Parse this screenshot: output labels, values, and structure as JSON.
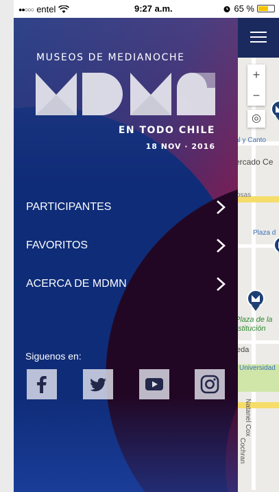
{
  "status_bar": {
    "carrier": "entel",
    "signal_dots": "●●○○○",
    "time": "9:27 a.m.",
    "battery_percent": "65 %",
    "battery_level": 0.65
  },
  "map": {
    "zoom_in": "+",
    "zoom_out": "−",
    "labels": [
      "al y Canto",
      "ercado Ce",
      "osas",
      "Plaza d",
      "Plaza de la",
      "nstitución",
      "eda",
      "Universidad",
      "Natanel Cox",
      "Cochran"
    ]
  },
  "drawer": {
    "logo": {
      "title": "MUSEOS DE MEDIANOCHE",
      "mark": "MDMN",
      "subtitle": "EN TODO CHILE",
      "date": "18 NOV · 2016"
    },
    "menu": [
      {
        "label": "PARTICIPANTES"
      },
      {
        "label": "FAVORITOS"
      },
      {
        "label": "ACERCA DE MDMN"
      }
    ],
    "social": {
      "label": "Siguenos en:",
      "icons": [
        "facebook-icon",
        "twitter-icon",
        "youtube-icon",
        "instagram-icon"
      ]
    }
  },
  "colors": {
    "drawer_blue": "#0f2c78",
    "drawer_red": "#b1142d",
    "drawer_dark": "#220724",
    "map_pin": "#1d3f73",
    "header_navy": "#1a2a5e"
  }
}
